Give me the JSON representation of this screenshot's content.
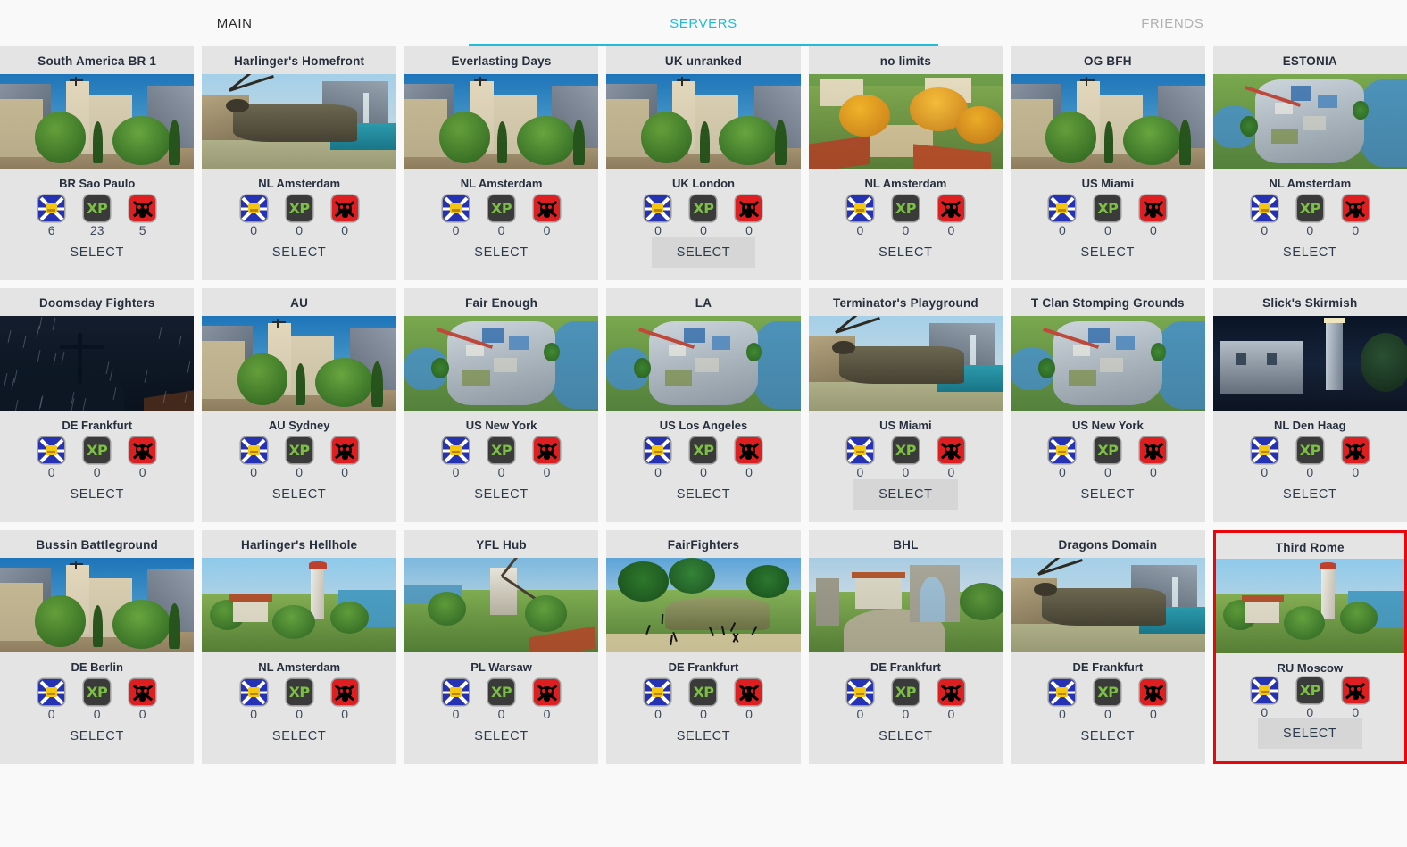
{
  "nav": {
    "tabs": [
      {
        "label": "MAIN",
        "state": "normal"
      },
      {
        "label": "SERVERS",
        "state": "active"
      },
      {
        "label": "FRIENDS",
        "state": "dim"
      }
    ]
  },
  "labels": {
    "select": "SELECT",
    "xp_badge_text": "XP"
  },
  "colors": {
    "accent": "#23bcd8",
    "page_bg": "#f9f9f9",
    "card_bg": "#e4e4e4",
    "selected_border": "#e8070c",
    "button_hover_bg": "#d6d6d6",
    "badge_players": "#2532b4",
    "badge_xp": "#3a3a3a",
    "badge_xp_text": "#7bc043",
    "badge_kills": "#dd1f22",
    "title_text": "#262f3d"
  },
  "servers": [
    {
      "name": "South America BR 1",
      "location": "BR Sao Paulo",
      "players": "6",
      "xp": "23",
      "kills": "5",
      "scene": "sc-town",
      "select_hover": false,
      "selected": false
    },
    {
      "name": "Harlinger's Homefront",
      "location": "NL Amsterdam",
      "players": "0",
      "xp": "0",
      "kills": "0",
      "scene": "sc-wreck",
      "select_hover": false,
      "selected": false
    },
    {
      "name": "Everlasting Days",
      "location": "NL Amsterdam",
      "players": "0",
      "xp": "0",
      "kills": "0",
      "scene": "sc-town",
      "select_hover": false,
      "selected": false
    },
    {
      "name": "UK unranked",
      "location": "UK London",
      "players": "0",
      "xp": "0",
      "kills": "0",
      "scene": "sc-town",
      "select_hover": true,
      "selected": false
    },
    {
      "name": "no limits",
      "location": "NL Amsterdam",
      "players": "0",
      "xp": "0",
      "kills": "0",
      "scene": "sc-autumn",
      "select_hover": false,
      "selected": false
    },
    {
      "name": "OG BFH",
      "location": "US Miami",
      "players": "0",
      "xp": "0",
      "kills": "0",
      "scene": "sc-town",
      "select_hover": false,
      "selected": false
    },
    {
      "name": "ESTONIA",
      "location": "NL Amsterdam",
      "players": "0",
      "xp": "0",
      "kills": "0",
      "scene": "sc-isle",
      "select_hover": false,
      "selected": false
    },
    {
      "name": "Doomsday Fighters",
      "location": "DE Frankfurt",
      "players": "0",
      "xp": "0",
      "kills": "0",
      "scene": "sc-dark",
      "select_hover": false,
      "selected": false
    },
    {
      "name": "AU",
      "location": "AU Sydney",
      "players": "0",
      "xp": "0",
      "kills": "0",
      "scene": "sc-town",
      "select_hover": false,
      "selected": false
    },
    {
      "name": "Fair Enough",
      "location": "US New York",
      "players": "0",
      "xp": "0",
      "kills": "0",
      "scene": "sc-isle",
      "select_hover": false,
      "selected": false
    },
    {
      "name": "LA",
      "location": "US Los Angeles",
      "players": "0",
      "xp": "0",
      "kills": "0",
      "scene": "sc-isle",
      "select_hover": false,
      "selected": false
    },
    {
      "name": "Terminator's Playground",
      "location": "US Miami",
      "players": "0",
      "xp": "0",
      "kills": "0",
      "scene": "sc-wreck",
      "select_hover": true,
      "selected": false
    },
    {
      "name": "T Clan Stomping Grounds",
      "location": "US New York",
      "players": "0",
      "xp": "0",
      "kills": "0",
      "scene": "sc-isle",
      "select_hover": false,
      "selected": false
    },
    {
      "name": "Slick's Skirmish",
      "location": "NL Den Haag",
      "players": "0",
      "xp": "0",
      "kills": "0",
      "scene": "sc-night",
      "select_hover": false,
      "selected": false
    },
    {
      "name": "Bussin Battleground",
      "location": "DE Berlin",
      "players": "0",
      "xp": "0",
      "kills": "0",
      "scene": "sc-town",
      "select_hover": false,
      "selected": false
    },
    {
      "name": "Harlinger's Hellhole",
      "location": "NL Amsterdam",
      "players": "0",
      "xp": "0",
      "kills": "0",
      "scene": "sc-light",
      "select_hover": false,
      "selected": false
    },
    {
      "name": "YFL Hub",
      "location": "PL Warsaw",
      "players": "0",
      "xp": "0",
      "kills": "0",
      "scene": "sc-mill",
      "select_hover": false,
      "selected": false
    },
    {
      "name": "FairFighters",
      "location": "DE Frankfurt",
      "players": "0",
      "xp": "0",
      "kills": "0",
      "scene": "sc-trop",
      "select_hover": false,
      "selected": false
    },
    {
      "name": "BHL",
      "location": "DE Frankfurt",
      "players": "0",
      "xp": "0",
      "kills": "0",
      "scene": "sc-ruin",
      "select_hover": false,
      "selected": false
    },
    {
      "name": "Dragons Domain",
      "location": "DE Frankfurt",
      "players": "0",
      "xp": "0",
      "kills": "0",
      "scene": "sc-wreck",
      "select_hover": false,
      "selected": false
    },
    {
      "name": "Third Rome",
      "location": "RU Moscow",
      "players": "0",
      "xp": "0",
      "kills": "0",
      "scene": "sc-light",
      "select_hover": true,
      "selected": true
    }
  ]
}
